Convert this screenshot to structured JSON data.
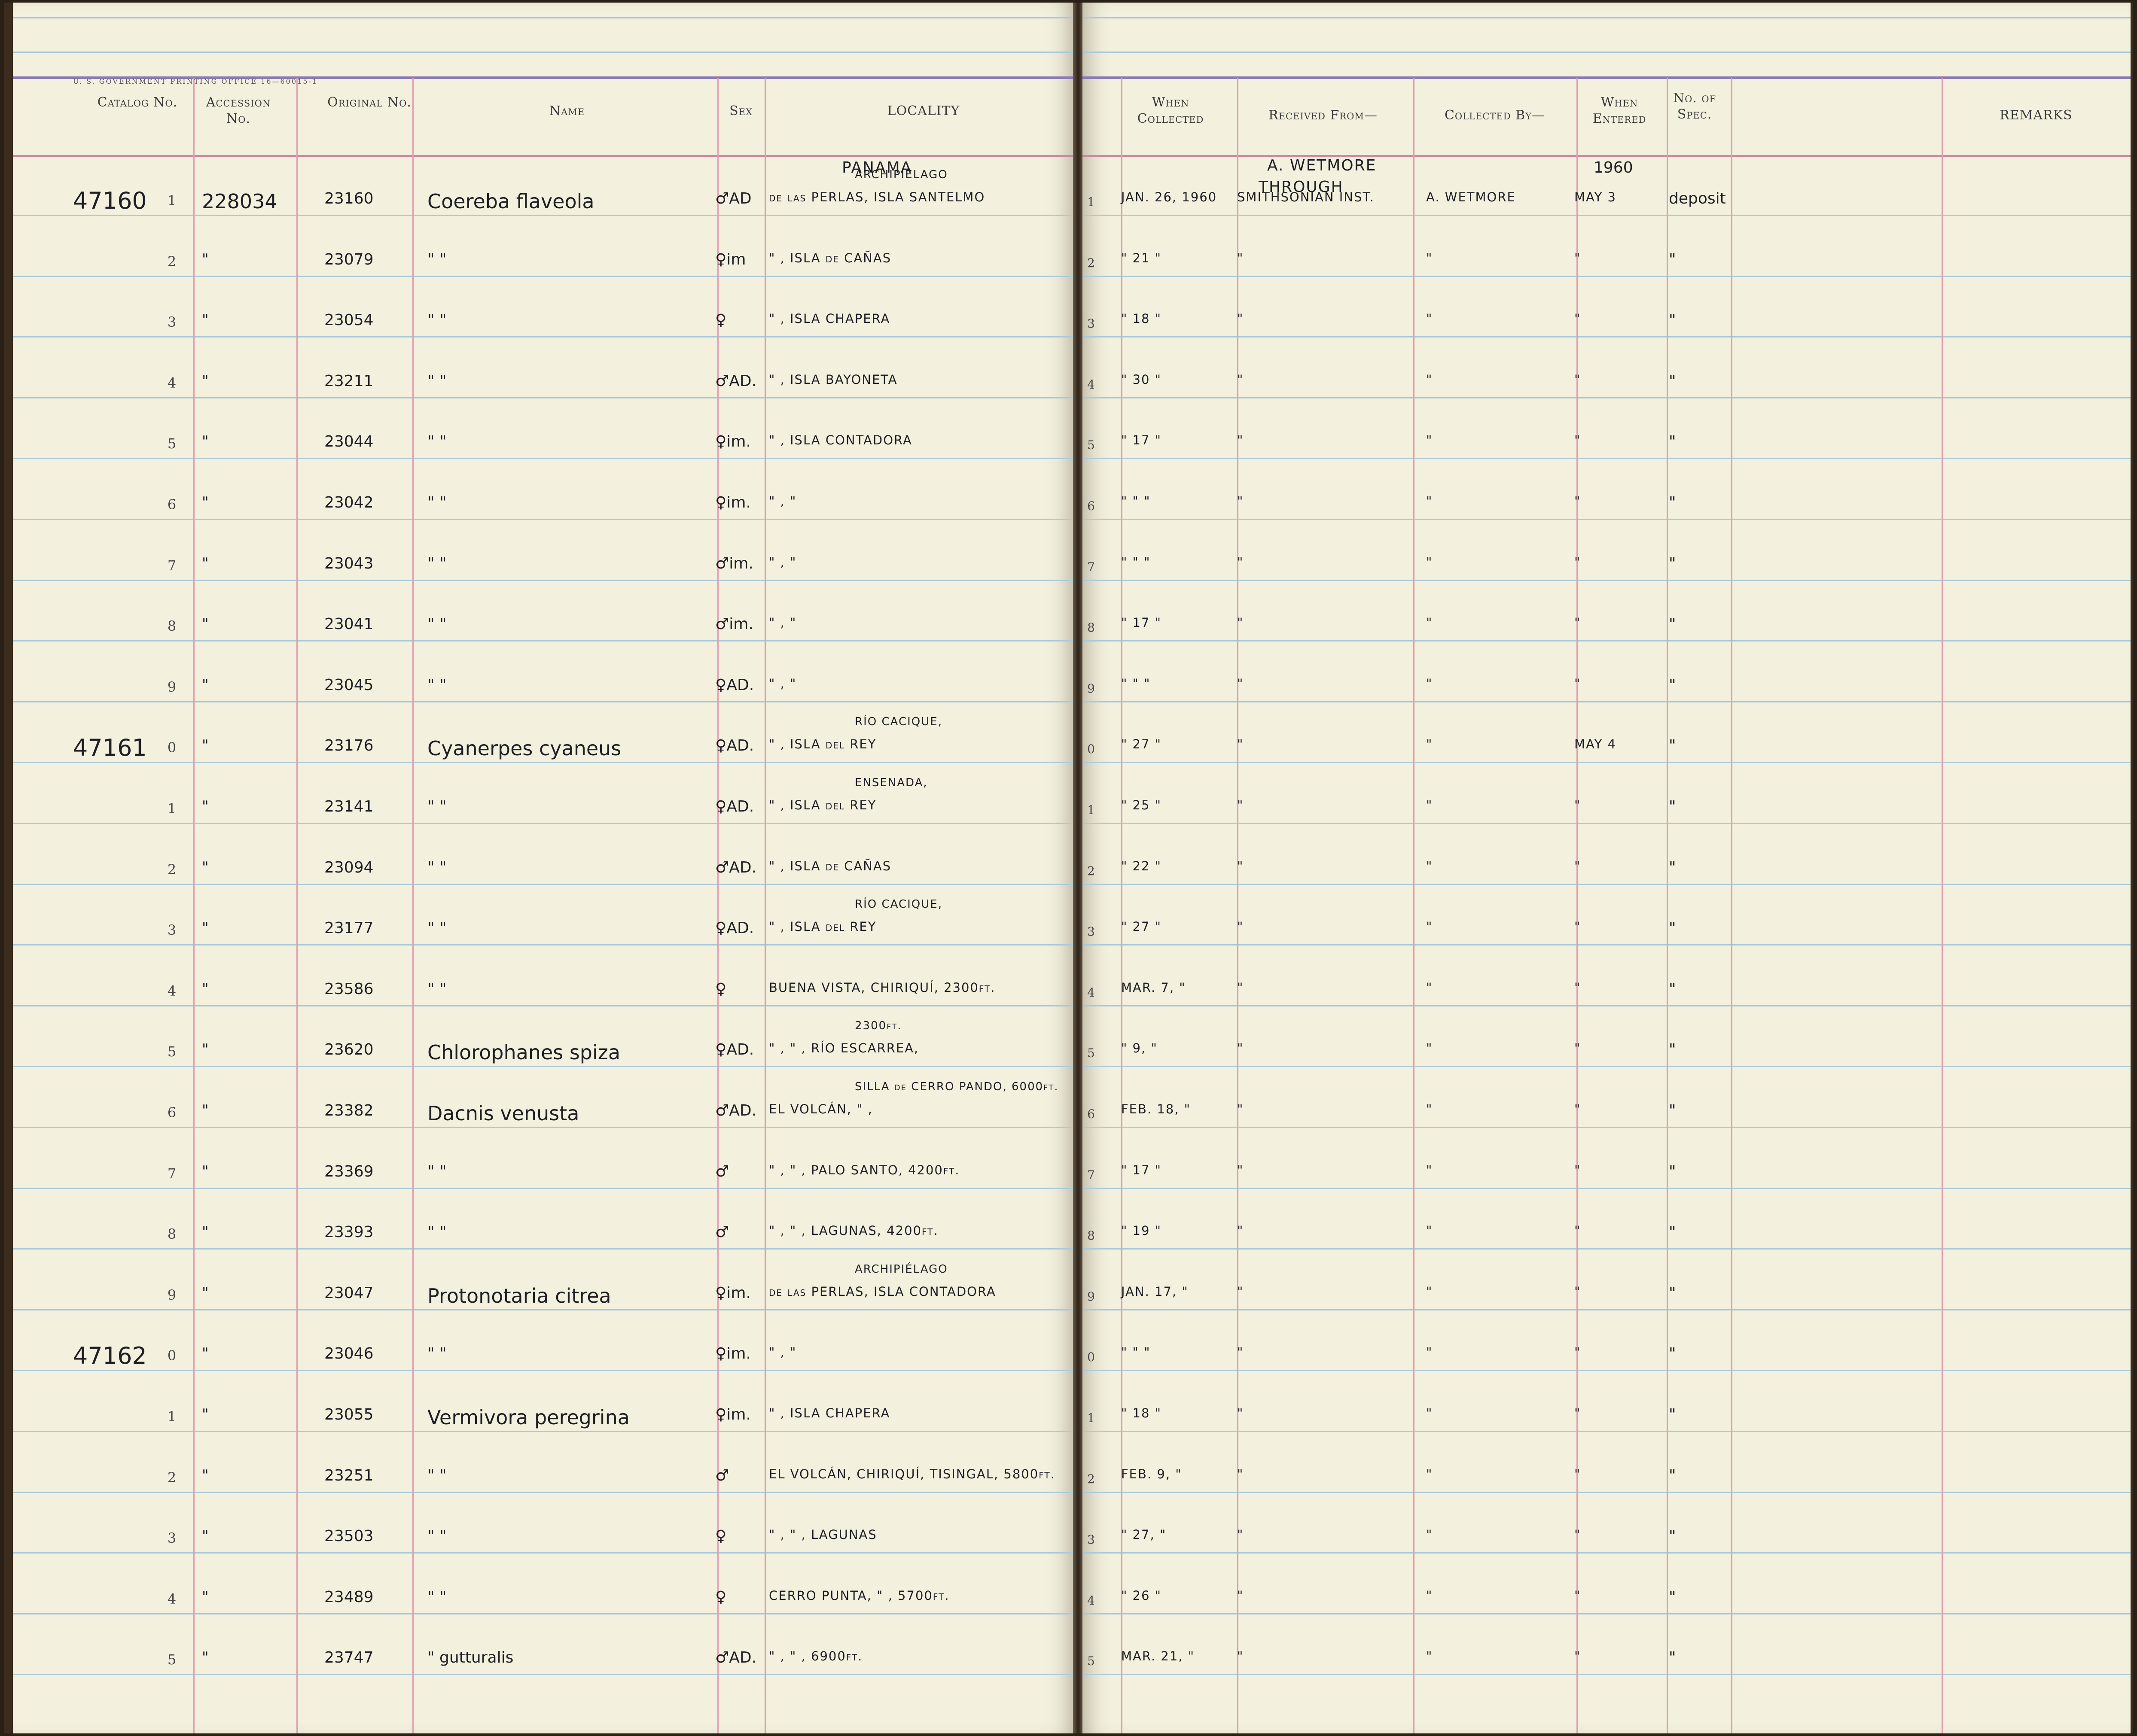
{
  "header": {
    "printer_note": "U. S. GOVERNMENT PRINTING OFFICE     16—60015-1",
    "catalog_no": "Catalog No.",
    "accession_no": "Accession No.",
    "original_no": "Original No.",
    "name": "Name",
    "sex": "Sex",
    "locality": "LOCALITY",
    "when_collected": "When Collected",
    "received_from": "Received From—",
    "collected_by": "Collected By—",
    "when_entered": "When Entered",
    "no_of_spec": "No. of Spec.",
    "remarks": "REMARKS"
  },
  "top_notes": {
    "country": "PANAMA",
    "received_line1": "A. WETMORE",
    "received_line2": "THROUGH",
    "year_entered": "1960"
  },
  "catalog_marks": [
    {
      "row": 0,
      "text": "47160"
    },
    {
      "row": 9,
      "text": "47161"
    },
    {
      "row": 19,
      "text": "47162"
    }
  ],
  "rows": [
    {
      "line": "1",
      "accession": "228034",
      "original": "23160",
      "name": "Coereba flaveola",
      "sex": "♂AD",
      "loc_above": "ARCHIPIÉLAGO",
      "loc": "de las PERLAS, ISLA SANTELMO",
      "date": "JAN. 26, 1960",
      "received": "SMITHSONIAN INST.",
      "collected": "A. WETMORE",
      "entered": "MAY 3",
      "spec": "deposit"
    },
    {
      "line": "2",
      "accession": "\"",
      "original": "23079",
      "name": "\"          \"",
      "sex": "♀im",
      "loc_above": "",
      "loc": "\"     , ISLA de CAÑAS",
      "date": "\" 21 \"",
      "received": "\"",
      "collected": "\"",
      "entered": "\"",
      "spec": "\""
    },
    {
      "line": "3",
      "accession": "\"",
      "original": "23054",
      "name": "\"          \"",
      "sex": "♀",
      "loc_above": "",
      "loc": "\"     , ISLA CHAPERA",
      "date": "\" 18 \"",
      "received": "\"",
      "collected": "\"",
      "entered": "\"",
      "spec": "\""
    },
    {
      "line": "4",
      "accession": "\"",
      "original": "23211",
      "name": "\"          \"",
      "sex": "♂AD.",
      "loc_above": "",
      "loc": "\"     , ISLA BAYONETA",
      "date": "\" 30 \"",
      "received": "\"",
      "collected": "\"",
      "entered": "\"",
      "spec": "\""
    },
    {
      "line": "5",
      "accession": "\"",
      "original": "23044",
      "name": "\"          \"",
      "sex": "♀im.",
      "loc_above": "",
      "loc": "\"     , ISLA CONTADORA",
      "date": "\" 17 \"",
      "received": "\"",
      "collected": "\"",
      "entered": "\"",
      "spec": "\""
    },
    {
      "line": "6",
      "accession": "\"",
      "original": "23042",
      "name": "\"          \"",
      "sex": "♀im.",
      "loc_above": "",
      "loc": "\"     ,       \"",
      "date": "\"   \"   \"",
      "received": "\"",
      "collected": "\"",
      "entered": "\"",
      "spec": "\""
    },
    {
      "line": "7",
      "accession": "\"",
      "original": "23043",
      "name": "\"          \"",
      "sex": "♂im.",
      "loc_above": "",
      "loc": "\"     ,       \"",
      "date": "\"   \"   \"",
      "received": "\"",
      "collected": "\"",
      "entered": "\"",
      "spec": "\""
    },
    {
      "line": "8",
      "accession": "\"",
      "original": "23041",
      "name": "\"          \"",
      "sex": "♂im.",
      "loc_above": "",
      "loc": "\"     ,       \"",
      "date": "\" 17 \"",
      "received": "\"",
      "collected": "\"",
      "entered": "\"",
      "spec": "\""
    },
    {
      "line": "9",
      "accession": "\"",
      "original": "23045",
      "name": "\"          \"",
      "sex": "♀AD.",
      "loc_above": "",
      "loc": "\"     ,       \"",
      "date": "\"   \"   \"",
      "received": "\"",
      "collected": "\"",
      "entered": "\"",
      "spec": "\""
    },
    {
      "line": "0",
      "accession": "\"",
      "original": "23176",
      "name": "Cyanerpes cyaneus",
      "sex": "♀AD.",
      "loc_above": "RÍO CACIQUE,",
      "loc": "\"     , ISLA del REY",
      "date": "\" 27 \"",
      "received": "\"",
      "collected": "\"",
      "entered": "MAY 4",
      "spec": "\""
    },
    {
      "line": "1",
      "accession": "\"",
      "original": "23141",
      "name": "\"          \"",
      "sex": "♀AD.",
      "loc_above": "ENSENADA,",
      "loc": "\"     , ISLA del REY",
      "date": "\" 25 \"",
      "received": "\"",
      "collected": "\"",
      "entered": "\"",
      "spec": "\""
    },
    {
      "line": "2",
      "accession": "\"",
      "original": "23094",
      "name": "\"          \"",
      "sex": "♂AD.",
      "loc_above": "",
      "loc": "\"     , ISLA de CAÑAS",
      "date": "\" 22 \"",
      "received": "\"",
      "collected": "\"",
      "entered": "\"",
      "spec": "\""
    },
    {
      "line": "3",
      "accession": "\"",
      "original": "23177",
      "name": "\"          \"",
      "sex": "♀AD.",
      "loc_above": "RÍO CACIQUE,",
      "loc": "\"     , ISLA del REY",
      "date": "\" 27 \"",
      "received": "\"",
      "collected": "\"",
      "entered": "\"",
      "spec": "\""
    },
    {
      "line": "4",
      "accession": "\"",
      "original": "23586",
      "name": "\"          \"",
      "sex": "♀",
      "loc_above": "",
      "loc": "BUENA VISTA, CHIRIQUÍ, 2300ft.",
      "date": "MAR. 7, \"",
      "received": "\"",
      "collected": "\"",
      "entered": "\"",
      "spec": "\""
    },
    {
      "line": "5",
      "accession": "\"",
      "original": "23620",
      "name": "Chlorophanes spiza",
      "sex": "♀AD.",
      "loc_above": "2300ft.",
      "loc": "\"   ,   \"   , RÍO ESCARREA,",
      "date": "\" 9, \"",
      "received": "\"",
      "collected": "\"",
      "entered": "\"",
      "spec": "\""
    },
    {
      "line": "6",
      "accession": "\"",
      "original": "23382",
      "name": "Dacnis venusta",
      "sex": "♂AD.",
      "loc_above": "SILLA de CERRO PANDO, 6000ft.",
      "loc": "EL VOLCÁN,  \"  ,",
      "date": "FEB. 18, \"",
      "received": "\"",
      "collected": "\"",
      "entered": "\"",
      "spec": "\""
    },
    {
      "line": "7",
      "accession": "\"",
      "original": "23369",
      "name": "\"          \"",
      "sex": "♂",
      "loc_above": "",
      "loc": "\"   ,  \" , PALO SANTO, 4200ft.",
      "date": "\" 17 \"",
      "received": "\"",
      "collected": "\"",
      "entered": "\"",
      "spec": "\""
    },
    {
      "line": "8",
      "accession": "\"",
      "original": "23393",
      "name": "\"          \"",
      "sex": "♂",
      "loc_above": "",
      "loc": "\"   ,  \" , LAGUNAS, 4200ft.",
      "date": "\" 19 \"",
      "received": "\"",
      "collected": "\"",
      "entered": "\"",
      "spec": "\""
    },
    {
      "line": "9",
      "accession": "\"",
      "original": "23047",
      "name": "Protonotaria citrea",
      "sex": "♀im.",
      "loc_above": "ARCHIPIÉLAGO",
      "loc": "de las PERLAS, ISLA CONTADORA",
      "date": "JAN. 17, \"",
      "received": "\"",
      "collected": "\"",
      "entered": "\"",
      "spec": "\""
    },
    {
      "line": "0",
      "accession": "\"",
      "original": "23046",
      "name": "\"          \"",
      "sex": "♀im.",
      "loc_above": "",
      "loc": "\"     ,       \"",
      "date": "\"   \"   \"",
      "received": "\"",
      "collected": "\"",
      "entered": "\"",
      "spec": "\""
    },
    {
      "line": "1",
      "accession": "\"",
      "original": "23055",
      "name": "Vermivora peregrina",
      "sex": "♀im.",
      "loc_above": "",
      "loc": "\"     , ISLA CHAPERA",
      "date": "\" 18 \"",
      "received": "\"",
      "collected": "\"",
      "entered": "\"",
      "spec": "\""
    },
    {
      "line": "2",
      "accession": "\"",
      "original": "23251",
      "name": "\"          \"",
      "sex": "♂",
      "loc_above": "",
      "loc": "EL VOLCÁN, CHIRIQUÍ, TISINGAL, 5800ft.",
      "date": "FEB. 9, \"",
      "received": "\"",
      "collected": "\"",
      "entered": "\"",
      "spec": "\""
    },
    {
      "line": "3",
      "accession": "\"",
      "original": "23503",
      "name": "\"          \"",
      "sex": "♀",
      "loc_above": "",
      "loc": "\"   ,  \" , LAGUNAS",
      "date": "\" 27, \"",
      "received": "\"",
      "collected": "\"",
      "entered": "\"",
      "spec": "\""
    },
    {
      "line": "4",
      "accession": "\"",
      "original": "23489",
      "name": "\"          \"",
      "sex": "♀",
      "loc_above": "",
      "loc": "CERRO PUNTA,  \" ,   5700ft.",
      "date": "\" 26 \"",
      "received": "\"",
      "collected": "\"",
      "entered": "\"",
      "spec": "\""
    },
    {
      "line": "5",
      "accession": "\"",
      "original": "23747",
      "name": "\"        gutturalis",
      "sex": "♂AD.",
      "loc_above": "",
      "loc": "\"   ,  \" ,   6900ft.",
      "date": "MAR. 21, \"",
      "received": "\"",
      "collected": "\"",
      "entered": "\"",
      "spec": "\""
    }
  ]
}
